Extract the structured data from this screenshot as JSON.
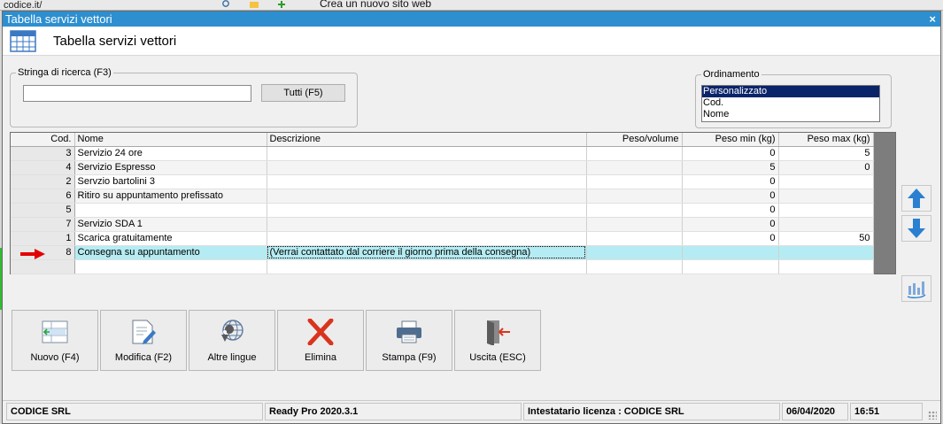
{
  "background": {
    "left_text": "codice.it/",
    "center_text": "Crea un nuovo sito web"
  },
  "window": {
    "title": "Tabella servizi vettori",
    "close_glyph": "×"
  },
  "header": {
    "title": "Tabella servizi vettori"
  },
  "search": {
    "legend": "Stringa di ricerca (F3)",
    "value": "",
    "all_button": "Tutti (F5)"
  },
  "sorting": {
    "legend": "Ordinamento",
    "options": [
      "Personalizzato",
      "Cod.",
      "Nome"
    ],
    "selected": "Personalizzato"
  },
  "grid": {
    "columns": [
      "Cod.",
      "Nome",
      "Descrizione",
      "Peso/volume",
      "Peso min (kg)",
      "Peso max (kg)"
    ],
    "rows": [
      {
        "cod": "3",
        "nome": "Servizio 24 ore",
        "descrizione": "",
        "peso_volume": "",
        "peso_min": "0",
        "peso_max": "5"
      },
      {
        "cod": "4",
        "nome": "Servizio Espresso",
        "descrizione": "",
        "peso_volume": "",
        "peso_min": "5",
        "peso_max": "0"
      },
      {
        "cod": "2",
        "nome": "Servzio bartolini 3",
        "descrizione": "",
        "peso_volume": "",
        "peso_min": "0",
        "peso_max": ""
      },
      {
        "cod": "6",
        "nome": "Ritiro su appuntamento prefissato",
        "descrizione": "",
        "peso_volume": "",
        "peso_min": "0",
        "peso_max": ""
      },
      {
        "cod": "5",
        "nome": "",
        "descrizione": "",
        "peso_volume": "",
        "peso_min": "0",
        "peso_max": ""
      },
      {
        "cod": "7",
        "nome": "Servizio SDA 1",
        "descrizione": "",
        "peso_volume": "",
        "peso_min": "0",
        "peso_max": ""
      },
      {
        "cod": "1",
        "nome": "Scarica gratuitamente",
        "descrizione": "",
        "peso_volume": "",
        "peso_min": "0",
        "peso_max": "50"
      },
      {
        "cod": "8",
        "nome": "Consegna su appuntamento",
        "descrizione": "(Verrai contattato dal corriere il giorno prima della consegna)",
        "peso_volume": "",
        "peso_min": "",
        "peso_max": ""
      }
    ],
    "selected_row_index": 7
  },
  "actions": [
    {
      "id": "nuovo",
      "label": "Nuovo (F4)",
      "icon": "new-record-icon"
    },
    {
      "id": "modifica",
      "label": "Modifica (F2)",
      "icon": "edit-document-icon"
    },
    {
      "id": "lingue",
      "label": "Altre lingue",
      "icon": "globe-pin-icon"
    },
    {
      "id": "elimina",
      "label": "Elimina",
      "icon": "delete-x-icon"
    },
    {
      "id": "stampa",
      "label": "Stampa (F9)",
      "icon": "printer-icon"
    },
    {
      "id": "uscita",
      "label": "Uscita (ESC)",
      "icon": "exit-door-icon"
    }
  ],
  "side_buttons": [
    {
      "icon": "arrow-up-icon"
    },
    {
      "icon": "arrow-down-icon"
    },
    {
      "icon": "sort-arrange-icon"
    }
  ],
  "statusbar": {
    "company": "CODICE SRL",
    "version": "Ready Pro 2020.3.1",
    "license": "Intestatario licenza : CODICE SRL",
    "date": "06/04/2020",
    "time": "16:51"
  },
  "colors": {
    "titlebar": "#2d8fcf",
    "selected_row": "#b5ecf3",
    "selected_option": "#0a246a",
    "arrow_blue": "#2b7fd0",
    "delete_red": "#d9341e",
    "row_marker_red": "#e30000"
  }
}
